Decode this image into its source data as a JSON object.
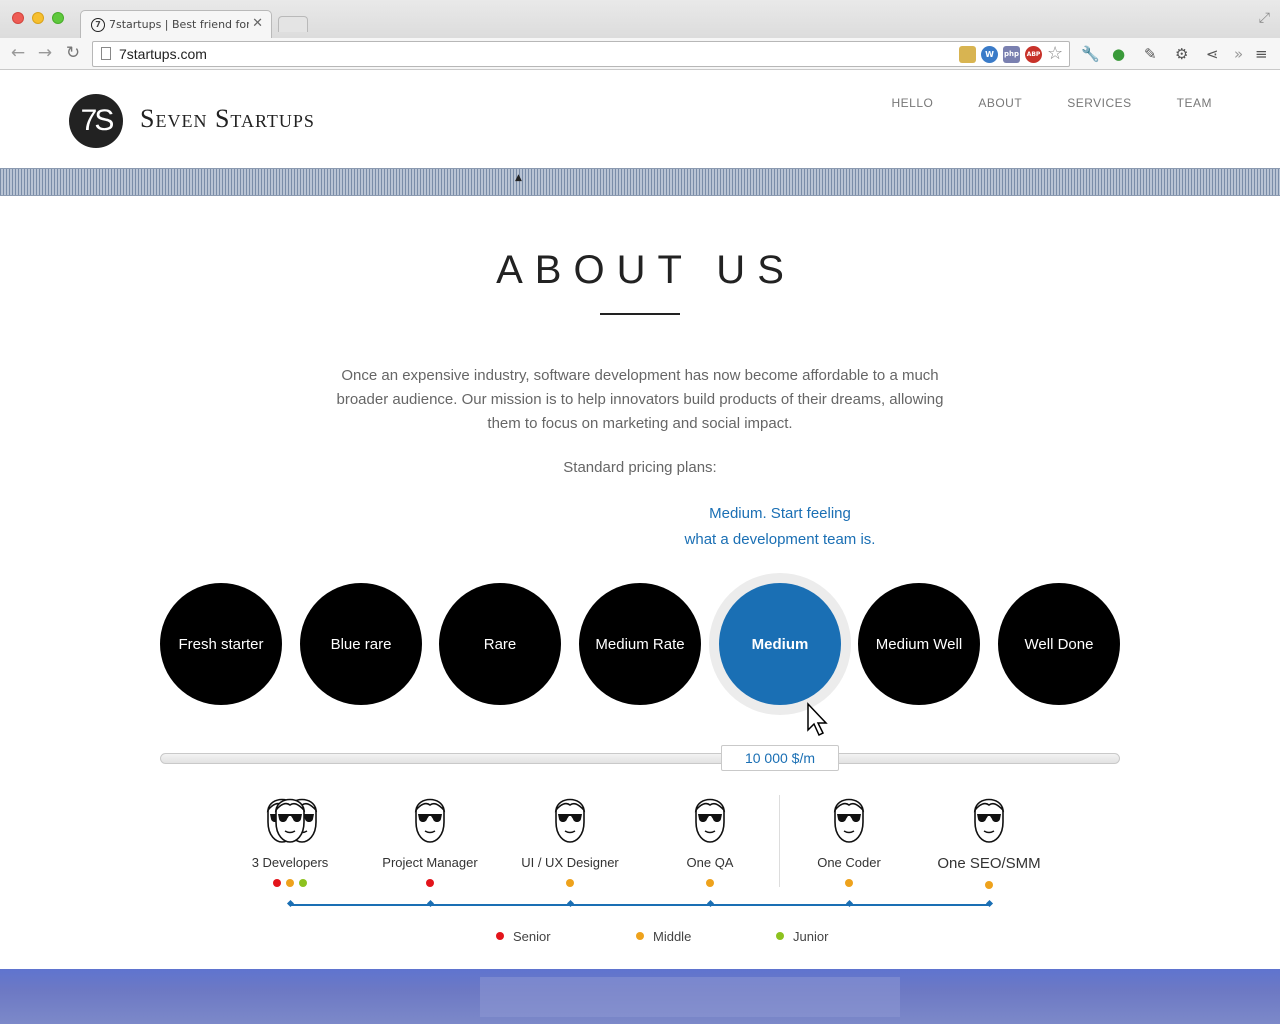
{
  "browser": {
    "tab_title": "7startups | Best friend for",
    "tab_favicon": "7",
    "url": "7startups.com",
    "extensions": [
      {
        "name": "chart-ext-icon",
        "color": "#c79a2c",
        "glyph": ""
      },
      {
        "name": "wordpress-ext-icon",
        "color": "#3a7bc8",
        "glyph": "W"
      },
      {
        "name": "php-ext-icon",
        "color": "#7a80b0",
        "glyph": "php"
      },
      {
        "name": "abp-ext-icon",
        "color": "#c8322a",
        "glyph": "ABP"
      }
    ]
  },
  "site": {
    "logo_mark": "7S",
    "logo_text": "Seven Startups",
    "nav": [
      "HELLO",
      "ABOUT",
      "SERVICES",
      "TEAM"
    ]
  },
  "about": {
    "title": "ABOUT US",
    "body": "Once an expensive industry, software development has now become affordable to a much broader audience. Our mission is to help innovators build products of their dreams, allowing them to focus on marketing and social impact.",
    "pricing_label": "Standard pricing plans:",
    "plan_caption_line1": "Medium. Start feeling",
    "plan_caption_line2": "what a development team is.",
    "plans": [
      "Fresh starter",
      "Blue rare",
      "Rare",
      "Medium Rate",
      "Medium",
      "Medium Well",
      "Well Done"
    ],
    "active_plan": "Medium",
    "price": "10 000 $/m",
    "team": [
      {
        "label": "3 Developers",
        "count": 3,
        "levels": [
          "senior",
          "middle",
          "junior"
        ]
      },
      {
        "label": "Project Manager",
        "count": 1,
        "levels": [
          "senior"
        ]
      },
      {
        "label": "UI / UX Designer",
        "count": 1,
        "levels": [
          "middle"
        ]
      },
      {
        "label": "One QA",
        "count": 1,
        "levels": [
          "middle"
        ]
      },
      {
        "label": "One Coder",
        "count": 1,
        "levels": [
          "middle"
        ]
      },
      {
        "label": "One SEO/SMM",
        "count": 1,
        "levels": [
          "middle"
        ]
      }
    ],
    "legend": [
      {
        "key": "senior",
        "label": "Senior",
        "color": "#e3141b"
      },
      {
        "key": "middle",
        "label": "Middle",
        "color": "#eea21c"
      },
      {
        "key": "junior",
        "label": "Junior",
        "color": "#8dc21f"
      }
    ],
    "accent_color": "#1a6fb4"
  }
}
